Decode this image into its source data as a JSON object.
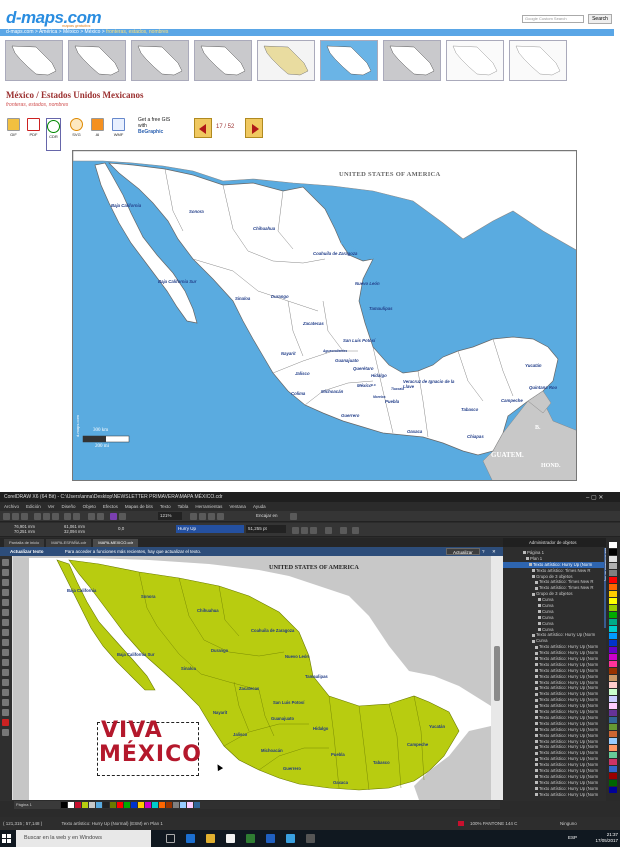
{
  "site": {
    "logo": "d-maps.com",
    "logo_sub": "mapas gratuitos",
    "search_placeholder": "Google Custom Search",
    "search_button": "Search",
    "breadcrumb": [
      "d-maps.com",
      "América",
      "México",
      "México"
    ],
    "breadcrumb_current": "fronteras, estados, nombres",
    "title": "México / Estados Unidos Mexicanos",
    "subtitle": "fronteras, estados, nombres",
    "formats": [
      "GIF",
      "PDF",
      "CDR",
      "SVG",
      "AI",
      "WMF"
    ],
    "gis_text_1": "Get a free GIS",
    "gis_text_2": "with",
    "gis_text_3": "BeGraphic",
    "pager": "17 / 52"
  },
  "map": {
    "usa": "UNITED STATES OF AMERICA",
    "guatemala": "GUATEM.",
    "honduras": "HOND.",
    "belize": "B.",
    "watermark": "d-maps.com",
    "scale_km": "300 km",
    "scale_mi": "200 mi",
    "states": [
      "Baja California",
      "Sonora",
      "Chihuahua",
      "Coahuila de Zaragoza",
      "Nuevo León",
      "Baja California Sur",
      "Sinaloa",
      "Durango",
      "Tamaulipas",
      "Zacatecas",
      "San Luis Potosí",
      "Nayarit",
      "Aguascalientes",
      "Guanajuato",
      "Querétaro",
      "Jalisco",
      "Hidalgo",
      "Colima",
      "Michoacán",
      "México",
      "Veracruz de Ignacio de la Llave",
      "Puebla",
      "Tlaxcala",
      "Morelos",
      "Guerrero",
      "Oaxaca",
      "Tabasco",
      "Chiapas",
      "Campeche",
      "Yucatán",
      "Quintana Roo",
      "D.F."
    ]
  },
  "corel": {
    "window_title": "CorelDRAW X6 (64 Bit) - C:\\Users\\anna\\Desktop\\NEWSLETTER PRIMAVERA\\MAPA MÉXICO.cdr",
    "menus": [
      "Archivo",
      "Edición",
      "Ver",
      "Diseño",
      "Objeto",
      "Efectos",
      "Mapas de bits",
      "Texto",
      "Tabla",
      "Herramientas",
      "Ventana",
      "Ayuda"
    ],
    "zoom": "121%",
    "snap": "Encajar en",
    "x_field": "76,901 mm",
    "y_field": "70,251 mm",
    "w_field": "61,061 mm",
    "h_field": "32,094 mm",
    "angle": "0,0",
    "font_name": "Hurry Up",
    "font_size": "51,255 pt",
    "tabs": [
      "Pantalla de inicio",
      "MAPA-ESPAÑA.cdr",
      "MAPA-MEXICO.cdr"
    ],
    "info_title": "Actualizar texto",
    "info_text": "Para acceder a funciones más recientes, hay que actualizar el texto.",
    "info_button": "Actualizar",
    "usa": "UNITED STATES OF AMERICA",
    "slogan_1": "VIVA",
    "slogan_2": "MÉXICO",
    "docker_title": "Administrador de objetos",
    "page_tab": "Página 1",
    "status_coords": "( 121,315 ; 57,148 )",
    "status_text": "Texto artístico: Hurry Up (Normal) (ESM) en Plan 1",
    "status_color": "100% PANTONE 144 C",
    "status_none": "Ninguno",
    "tree": [
      "Página 1",
      "Plan 1",
      "Texto artístico: Hurry Up (Norm",
      "Texto artístico: Times New R",
      "Grupo de 3 objetos",
      "Texto artístico: Times New R",
      "Texto artístico: Times New R",
      "Grupo de 3 objetos",
      "Curva",
      "Curva",
      "Curva",
      "Curva",
      "Curva",
      "Curva",
      "Texto artístico: Hurry Up (Norm",
      "Curva",
      "Texto artístico: Hurry Up (Norm",
      "Texto artístico: Hurry Up (Norm",
      "Texto artístico: Hurry Up (Norm",
      "Texto artístico: Hurry Up (Norm",
      "Texto artístico: Hurry Up (Norm",
      "Texto artístico: Hurry Up (Norm",
      "Texto artístico: Hurry Up (Norm",
      "Texto artístico: Hurry Up (Norm",
      "Texto artístico: Hurry Up (Norm",
      "Texto artístico: Hurry Up (Norm",
      "Texto artístico: Hurry Up (Norm",
      "Texto artístico: Hurry Up (Norm",
      "Texto artístico: Hurry Up (Norm",
      "Texto artístico: Hurry Up (Norm",
      "Texto artístico: Hurry Up (Norm",
      "Texto artístico: Hurry Up (Norm",
      "Texto artístico: Hurry Up (Norm",
      "Texto artístico: Hurry Up (Norm",
      "Texto artístico: Hurry Up (Norm",
      "Texto artístico: Hurry Up (Norm",
      "Texto artístico: Hurry Up (Norm",
      "Texto artístico: Hurry Up (Norm",
      "Texto artístico: Hurry Up (Norm",
      "Texto artístico: Hurry Up (Norm",
      "Texto artístico: Hurry Up (Norm",
      "Texto artístico: Hurry Up (Norm"
    ],
    "docker_side_tab": "Administrador de obj"
  },
  "taskbar": {
    "search_placeholder": "Buscar en la web y en Windows",
    "time": "21:37",
    "date": "17/05/2017",
    "lang": "ESP"
  },
  "colors": {
    "accent_blue": "#2a8de0",
    "sea": "#5aabe0",
    "land": "#ffffff",
    "mexico_green": "#b8cc10",
    "title_red": "#9b3030"
  }
}
